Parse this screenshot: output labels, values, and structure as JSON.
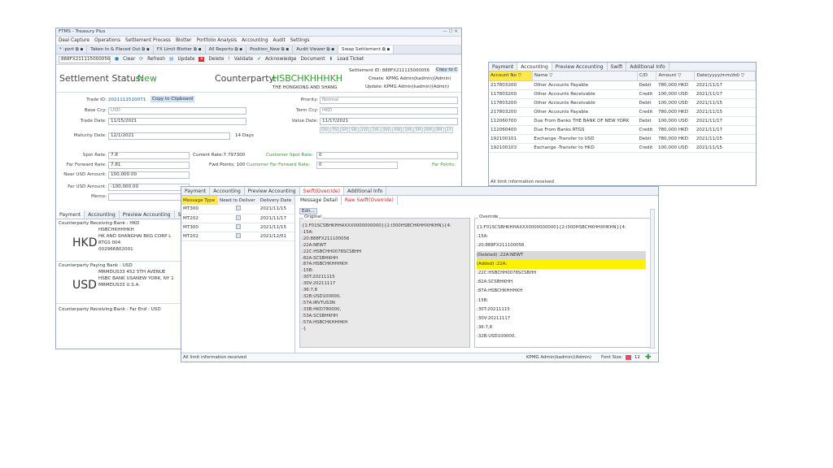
{
  "main": {
    "title": "FTMS - Treasury Plus",
    "window_controls": "— ☐ ✕",
    "menu": [
      "Deal Capture",
      "Operations",
      "Settlement Process",
      "Blotter",
      "Portfolio Analysis",
      "Accounting",
      "Audit",
      "Settings"
    ],
    "doc_tabs": [
      "* :port",
      "Taken In & Placed Out",
      "FX Limit Blotter",
      "All Reports",
      "Position_New",
      "Audit Viewer",
      "Swap Settlement"
    ],
    "toolbar": {
      "ticket_id": "888FX211115000056",
      "clear": "Clear",
      "refresh": "Refresh",
      "update": "Update",
      "delete": "Delete",
      "validate": "Validate",
      "acknowledge": "Acknowledge",
      "document": "Document",
      "load_ticket": "Load Ticket"
    },
    "header": {
      "status_label": "Settlement Status:",
      "status_value": "New",
      "cp_label": "Counterparty:",
      "cp_value": "HSBCHKHHHKH",
      "cp_name": "THE HONGKONG AND SHANG",
      "settlement_id": "Settlement ID: 888FX211115000056",
      "copy": "Copy to C",
      "create": "Create: KPMG Admin(kadmin)(Admin)",
      "update": "Update: KPMG Admin(kadmin)(Admin)"
    },
    "form": {
      "trade_id_label": "Trade ID:",
      "trade_id": "2021111510071",
      "copy_clipboard": "Copy to Clipboard",
      "base_ccy_label": "Base Ccy:",
      "base_ccy": "USD",
      "trade_date_label": "Trade Date:",
      "trade_date": "11/15/2021",
      "maturity_label": "Maturity Date:",
      "maturity": "12/1/2021",
      "days": "14 Days",
      "priority_label": "Priority:",
      "priority": "Normal",
      "term_ccy_label": "Term Ccy:",
      "term_ccy": "HKD",
      "value_date_label": "Value Date:",
      "value_date": "11/17/2021",
      "tenors": [
        "ON",
        "TN",
        "SP",
        "SN",
        "1W",
        "2W",
        "3W",
        "4W",
        "1M",
        "3M",
        "6M",
        "9M",
        "1Y"
      ],
      "spot_rate_label": "Spot Rate:",
      "spot_rate": "7.8",
      "current_rate": "Current Rate:7.797300",
      "cust_spot_label": "Customer Spot Rate:",
      "cust_spot": "0",
      "far_fwd_label": "Far Forward Rate:",
      "far_fwd": "7.81",
      "fwd_points": "Fwd Points: 100",
      "cust_far_label": "Customer Far Forward Rate:",
      "cust_far": "0",
      "far_points": "Far Points:",
      "near_usd_label": "Near USD Amount:",
      "near_usd": "100,000.00",
      "far_usd_label": "Far USD Amount:",
      "far_usd": "-100,000.00",
      "memo_label": "Memo:"
    },
    "bottom_tabs": [
      "Payment",
      "Accounting",
      "Preview Accounting",
      "Su"
    ],
    "recv": {
      "title": "Counterparty Receiving Bank : HKD",
      "ccy": "HKD",
      "lines": [
        "HSBCHKHHHKH",
        "HK AND SHANGHAI BKG CORP L",
        "RTGS 004",
        "002966802001"
      ]
    },
    "pay": {
      "title": "Counterparty Paying Bank : USD",
      "ccy": "USD",
      "lines": [
        "MRMDUS33      452 5TH AVENUE",
        "HSBC BANK USANEW YORK, NY 1",
        "MRMDUS33      U.S.A."
      ]
    },
    "far": {
      "title": "Counterparty Receiving Bank - Far End : USD"
    },
    "status": "All limit information received"
  },
  "accounting": {
    "tabs": [
      "Payment",
      "Accounting",
      "Preview Accounting",
      "Swift",
      "Additional Info"
    ],
    "columns": [
      "Account No",
      "Name",
      "C/D",
      "Amount",
      "Date(yyyy/mm/dd)"
    ],
    "rows": [
      [
        "217803200",
        "Other Accounts Payable",
        "Debit",
        "780,000 HKD",
        "2021/11/17"
      ],
      [
        "117803200",
        "Other Accounts Receivable",
        "Credit",
        "100,000 USD",
        "2021/11/17"
      ],
      [
        "117803200",
        "Other Accounts Receivable",
        "Debit",
        "100,000 USD",
        "2021/11/15"
      ],
      [
        "217803200",
        "Other Accounts Payable",
        "Credit",
        "780,000 HKD",
        "2021/11/15"
      ],
      [
        "112060700",
        "Due From Banks THE BANK OF NEW YORK",
        "Debit",
        "100,000 USD",
        "2021/11/17"
      ],
      [
        "112060400",
        "Due From Banks RTGS",
        "Credit",
        "780,000 HKD",
        "2021/11/17"
      ],
      [
        "192100101",
        "Exchange -Transfer to USD",
        "Debit",
        "780,000 HKD",
        "2021/11/15"
      ],
      [
        "192100103",
        "Exchange -Transfer to HKD",
        "Credit",
        "100,000 USD",
        "2021/11/15"
      ]
    ],
    "status": "All limit information received"
  },
  "swift": {
    "tabs": [
      "Payment",
      "Accounting",
      "Preview Accounting",
      "Swift(Override)",
      "Additional Info"
    ],
    "msg_columns": [
      "Message Type",
      "Need to Deliver",
      "Delivery Date"
    ],
    "messages": [
      [
        "MT300",
        "2021/11/15"
      ],
      [
        "MT202",
        "2021/11/17"
      ],
      [
        "MT300",
        "2021/11/15"
      ],
      [
        "MT202",
        "2021/12/01"
      ]
    ],
    "detail_tabs": [
      "Message Detail",
      "Raw Swift(Override)"
    ],
    "edit": "Edit...",
    "original_label": "Original",
    "original_lines": [
      "{1:F01SCSBHKHHAXXX0000000000}{2:I300HSBCHKHHXHKHN}{4:",
      ":15A:",
      ":20:888FX211100056",
      ":22A:NEWT",
      ":22C:HSBCHH0078SCSBHH",
      ":82A:SCSBHKHH",
      ":87A:HSBCHKHHHKH",
      ":15B:",
      ":30T:20211115",
      ":30V:20211117",
      ":36:7,8",
      ":32B:USD100000,",
      ":57A:IRVTUS3N",
      ":33B:HKD780000,",
      ":53A:SCSBHKHH",
      ":57A:HSBCHKHHHKH",
      "-}"
    ],
    "override_label": "Override",
    "override_lines": [
      "{1:F01SCSBHKHHAXXX0000000000}{2:I300HSBCHKHHXHKHN}{4:",
      ":15A:",
      ":20:888FX211100056",
      "(Deleted) :22A:NEWT",
      "(Added) :22A:",
      ":22C:HSBCHH0078SCSBHH",
      ":82A:SCSBHKHH",
      ":87A:HSBCHKHHHKH",
      ":15B:",
      ":30T:20211115",
      ":30V:20211117",
      ":36:7,8",
      ":32B:USD100000,"
    ],
    "status": "All limit information received",
    "user": "KPMG Admin(kadmin)(Admin)",
    "font_size_label": "Font Size:",
    "font_size": "12"
  },
  "colors": {
    "status_green": "#2e9e2e",
    "highlight_yellow": "#fff200",
    "deleted_gray": "#d9d9d9",
    "accent_blue": "#1a5fb4"
  }
}
